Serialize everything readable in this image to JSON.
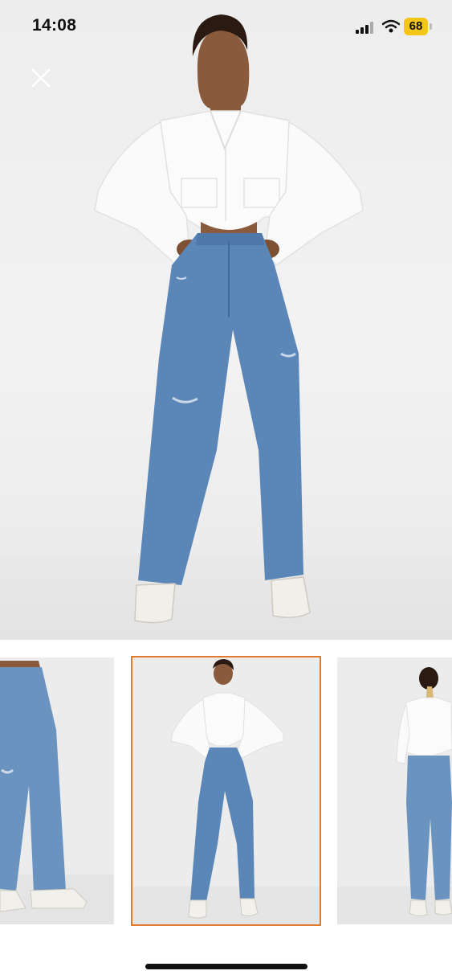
{
  "status_bar": {
    "time": "14:08",
    "battery_level": "68",
    "icons": [
      "signal-icon",
      "wifi-icon",
      "battery-icon"
    ]
  },
  "close_icon": "close-icon",
  "gallery": {
    "thumbnails": [
      {
        "name": "thumbnail-jeans-closeup",
        "selected": false
      },
      {
        "name": "thumbnail-front-view",
        "selected": true
      },
      {
        "name": "thumbnail-back-view",
        "selected": false
      }
    ],
    "accent_color": "#e07a2f"
  }
}
